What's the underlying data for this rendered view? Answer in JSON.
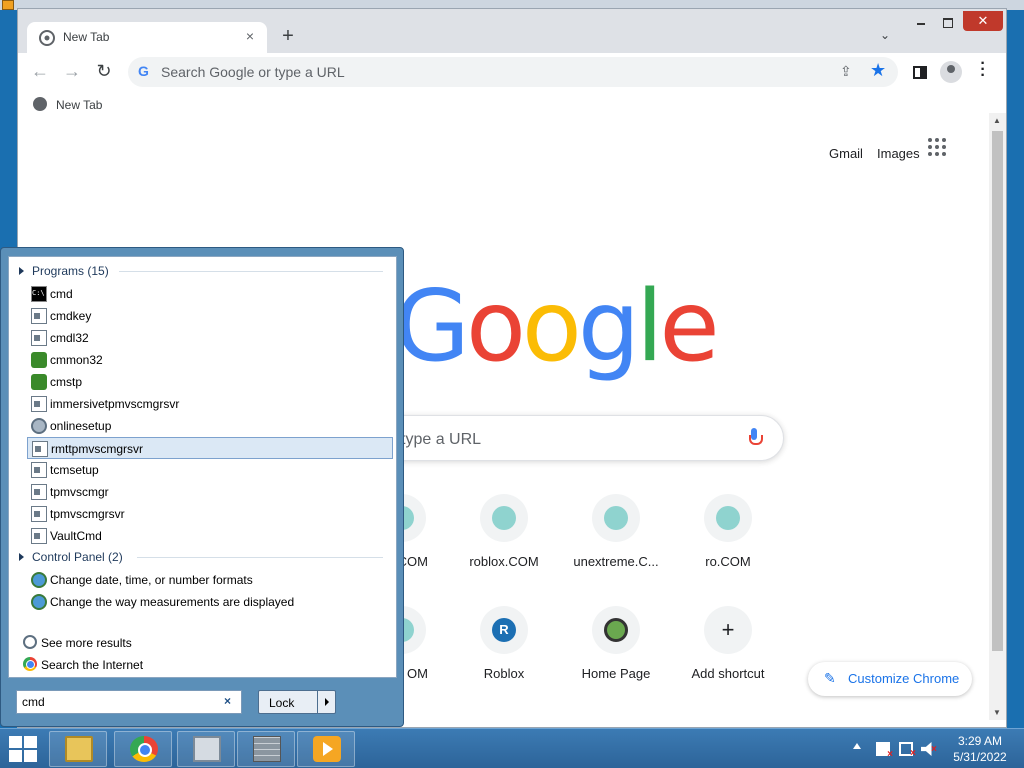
{
  "chrome": {
    "tab_title": "New Tab",
    "tab_close": "×",
    "new_tab": "+",
    "tab_search": "⌄",
    "close_btn": "✕",
    "omnibox_placeholder": "Search Google or type a URL",
    "bookmark_label": "New Tab",
    "links": {
      "gmail": "Gmail",
      "images": "Images"
    },
    "search_placeholder_visible": "type a URL",
    "shortcuts_row1": [
      {
        "label": ".COM",
        "letter": "",
        "color": "#8fd3cf"
      },
      {
        "label": "roblox.COM",
        "letter": "",
        "color": "#8fd3cf"
      },
      {
        "label": "unextreme.C...",
        "letter": "",
        "color": "#8fd3cf"
      },
      {
        "label": "ro.COM",
        "letter": "",
        "color": "#8fd3cf"
      }
    ],
    "shortcuts_row2": [
      {
        "label": "OM",
        "letter": "",
        "color": "#8fd3cf"
      },
      {
        "label": "Roblox",
        "letter": "R",
        "color": "#1c6fb3"
      },
      {
        "label": "Home Page",
        "letter": "",
        "color": "#6aa84f"
      },
      {
        "label": "Add shortcut",
        "letter": "+",
        "color": "#f1f3f4"
      }
    ],
    "customize_label": "Customize Chrome"
  },
  "start_menu": {
    "programs_header": "Programs (15)",
    "programs": [
      {
        "label": "cmd",
        "icon": "cmd-icon"
      },
      {
        "label": "cmdkey",
        "icon": "window-icon"
      },
      {
        "label": "cmdl32",
        "icon": "window-icon"
      },
      {
        "label": "cmmon32",
        "icon": "green-icon"
      },
      {
        "label": "cmstp",
        "icon": "green-icon"
      },
      {
        "label": "immersivetpmvscmgrsvr",
        "icon": "window-icon"
      },
      {
        "label": "onlinesetup",
        "icon": "gear-icon"
      },
      {
        "label": "rmttpmvscmgrsvr",
        "icon": "window-icon"
      },
      {
        "label": "tcmsetup",
        "icon": "window-icon"
      },
      {
        "label": "tpmvscmgr",
        "icon": "window-icon"
      },
      {
        "label": "tpmvscmgrsvr",
        "icon": "window-icon"
      },
      {
        "label": "VaultCmd",
        "icon": "window-icon"
      }
    ],
    "control_panel_header": "Control Panel (2)",
    "control_panel": [
      {
        "label": "Change date, time, or number formats"
      },
      {
        "label": "Change the way measurements are displayed"
      }
    ],
    "see_more": "See more results",
    "search_internet": "Search the Internet",
    "search_value": "cmd",
    "clear": "×",
    "lock_label": "Lock"
  },
  "taskbar": {
    "time": "3:29 AM",
    "date": "5/31/2022"
  },
  "colors": {
    "google_blue": "#4285f4",
    "google_red": "#ea4335",
    "google_yellow": "#fbbc05",
    "google_green": "#34a853",
    "accent": "#1a73e8"
  }
}
